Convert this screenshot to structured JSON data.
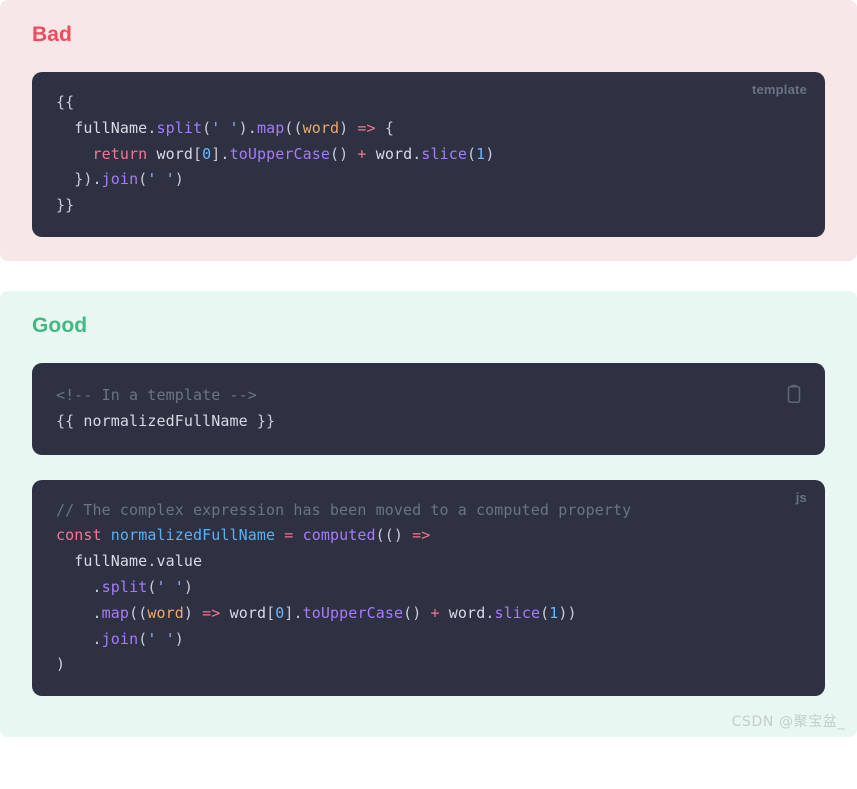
{
  "sections": [
    {
      "id": "bad",
      "title": "Bad",
      "title_color": "#ef4a5e",
      "background": "#f7e8e7",
      "blocks": [
        {
          "id": "bad-template",
          "lang_badge": "template",
          "has_copy_button": false,
          "code_text": "{{\n  fullName.split(' ').map((word) => {\n    return word[0].toUpperCase() + word.slice(1)\n  }).join(' ')\n}}"
        }
      ]
    },
    {
      "id": "good",
      "title": "Good",
      "title_color": "#42b883",
      "background": "#e8f7f2",
      "blocks": [
        {
          "id": "good-template",
          "lang_badge": "",
          "has_copy_button": true,
          "copy_icon": "clipboard-icon",
          "code_text": "<!-- In a template -->\n{{ normalizedFullName }}"
        },
        {
          "id": "good-js",
          "lang_badge": "js",
          "has_copy_button": false,
          "code_text": "// The complex expression has been moved to a computed property\nconst normalizedFullName = computed(() =>\n  fullName.value\n    .split(' ')\n    .map((word) => word[0].toUpperCase() + word.slice(1))\n    .join(' ')\n)"
        }
      ]
    }
  ],
  "code_theme": {
    "background": "#2d3142",
    "text": "#d7dae3",
    "function": "#a77bfa",
    "string": "#96b1f5",
    "parameter": "#f0a868",
    "operator": "#f4768e",
    "keyword": "#f4768e",
    "number": "#6cb6ff",
    "variable": "#5ab0f6",
    "comment": "#6d7383"
  },
  "watermark": "CSDN @聚宝盆_"
}
